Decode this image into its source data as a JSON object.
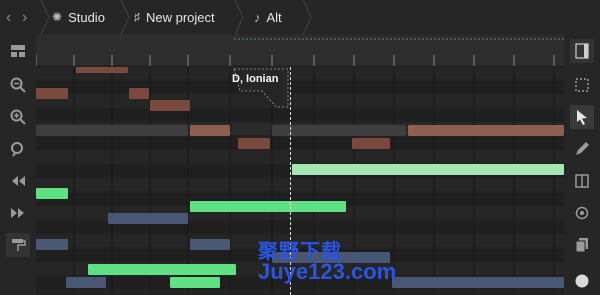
{
  "breadcrumbs": [
    {
      "label": "Studio",
      "icon": "sun-icon"
    },
    {
      "label": "New project",
      "icon": "guitar-icon"
    },
    {
      "label": "Alt",
      "icon": "music-note-icon"
    }
  ],
  "scale_label": "D, Ionian",
  "watermark": {
    "line1": "聚野下载",
    "line2": "Juye123.com"
  },
  "colors": {
    "accent_green": "#6ee58a",
    "light_green": "#9ee8ad",
    "brown": "#8a5a4a",
    "slate_blue": "#495a78",
    "gray_note": "#4a4a4a",
    "playhead": "#dcdcdc"
  },
  "left_tools": [
    "layout-icon",
    "zoom-out-icon",
    "zoom-in-icon",
    "zoom-fit-icon",
    "rewind-icon",
    "fast-forward-icon",
    "paint-roller-icon"
  ],
  "right_tools": [
    "panel-toggle-icon",
    "select-rectangle-icon",
    "pointer-icon",
    "pencil-icon",
    "split-icon",
    "settings-icon",
    "copy-icon",
    "record-icon"
  ]
}
